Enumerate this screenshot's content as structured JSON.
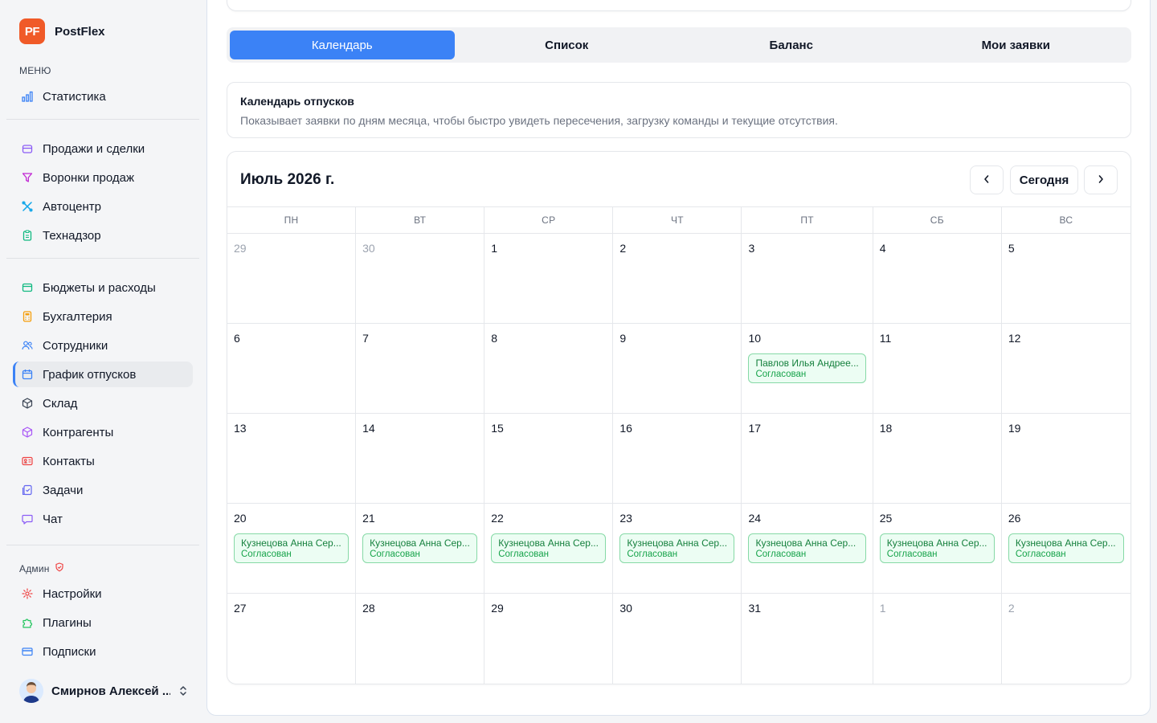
{
  "brand": {
    "logo": "PF",
    "name": "PostFlex"
  },
  "sidebar": {
    "menu_title": "МЕНЮ",
    "items": [
      {
        "label": "Статистика",
        "icon": "bar-chart-icon",
        "color": "#3b82f6"
      },
      {
        "label": "Продажи и сделки",
        "icon": "box-icon",
        "color": "#8b5cf6"
      },
      {
        "label": "Воронки продаж",
        "icon": "funnel-icon",
        "color": "#c026d3"
      },
      {
        "label": "Автоцентр",
        "icon": "wrench-icon",
        "color": "#0ea5e9"
      },
      {
        "label": "Технадзор",
        "icon": "clipboard-icon",
        "color": "#10b981"
      },
      {
        "label": "Бюджеты и расходы",
        "icon": "wallet-icon",
        "color": "#10b981"
      },
      {
        "label": "Бухгалтерия",
        "icon": "calculator-icon",
        "color": "#f59e0b"
      },
      {
        "label": "Сотрудники",
        "icon": "users-icon",
        "color": "#3b82f6"
      },
      {
        "label": "График отпусков",
        "icon": "calendar-icon",
        "color": "#3b82f6"
      },
      {
        "label": "Склад",
        "icon": "package-icon",
        "color": "#374151"
      },
      {
        "label": "Контрагенты",
        "icon": "cube-icon",
        "color": "#a855f7"
      },
      {
        "label": "Контакты",
        "icon": "contact-card-icon",
        "color": "#ef4444"
      },
      {
        "label": "Задачи",
        "icon": "tasks-icon",
        "color": "#6366f1"
      },
      {
        "label": "Чат",
        "icon": "chat-icon",
        "color": "#8b5cf6"
      }
    ],
    "admin_title": "Админ",
    "admin_items": [
      {
        "label": "Настройки",
        "icon": "gear-icon",
        "color": "#ef4444"
      },
      {
        "label": "Плагины",
        "icon": "puzzle-icon",
        "color": "#22c55e"
      },
      {
        "label": "Подписки",
        "icon": "credit-card-icon",
        "color": "#3b82f6"
      }
    ],
    "user_name": "Смирнов Алексей ..."
  },
  "tabs": [
    {
      "label": "Календарь",
      "active": true
    },
    {
      "label": "Список",
      "active": false
    },
    {
      "label": "Баланс",
      "active": false
    },
    {
      "label": "Мои заявки",
      "active": false
    }
  ],
  "info": {
    "title": "Календарь отпусков",
    "description": "Показывает заявки по дням месяца, чтобы быстро увидеть пересечения, загрузку команды и текущие отсутствия."
  },
  "calendar": {
    "month_title": "Июль 2026 г.",
    "prev_label": "‹",
    "today_label": "Сегодня",
    "next_label": "›",
    "weekdays": [
      "ПН",
      "ВТ",
      "СР",
      "ЧТ",
      "ПТ",
      "СБ",
      "ВС"
    ],
    "days": [
      {
        "n": "29",
        "muted": true
      },
      {
        "n": "30",
        "muted": true
      },
      {
        "n": "1"
      },
      {
        "n": "2"
      },
      {
        "n": "3"
      },
      {
        "n": "4"
      },
      {
        "n": "5"
      },
      {
        "n": "6"
      },
      {
        "n": "7"
      },
      {
        "n": "8"
      },
      {
        "n": "9"
      },
      {
        "n": "10",
        "event": {
          "name": "Павлов Илья Андрее...",
          "status": "Согласован"
        }
      },
      {
        "n": "11"
      },
      {
        "n": "12"
      },
      {
        "n": "13"
      },
      {
        "n": "14"
      },
      {
        "n": "15"
      },
      {
        "n": "16"
      },
      {
        "n": "17"
      },
      {
        "n": "18"
      },
      {
        "n": "19"
      },
      {
        "n": "20",
        "event": {
          "name": "Кузнецова Анна Сер...",
          "status": "Согласован"
        }
      },
      {
        "n": "21",
        "event": {
          "name": "Кузнецова Анна Сер...",
          "status": "Согласован"
        }
      },
      {
        "n": "22",
        "event": {
          "name": "Кузнецова Анна Сер...",
          "status": "Согласован"
        }
      },
      {
        "n": "23",
        "event": {
          "name": "Кузнецова Анна Сер...",
          "status": "Согласован"
        }
      },
      {
        "n": "24",
        "event": {
          "name": "Кузнецова Анна Сер...",
          "status": "Согласован"
        }
      },
      {
        "n": "25",
        "event": {
          "name": "Кузнецова Анна Сер...",
          "status": "Согласован"
        }
      },
      {
        "n": "26",
        "event": {
          "name": "Кузнецова Анна Сер...",
          "status": "Согласован"
        }
      },
      {
        "n": "27"
      },
      {
        "n": "28"
      },
      {
        "n": "29"
      },
      {
        "n": "30"
      },
      {
        "n": "31"
      },
      {
        "n": "1",
        "muted": true
      },
      {
        "n": "2",
        "muted": true
      }
    ]
  }
}
